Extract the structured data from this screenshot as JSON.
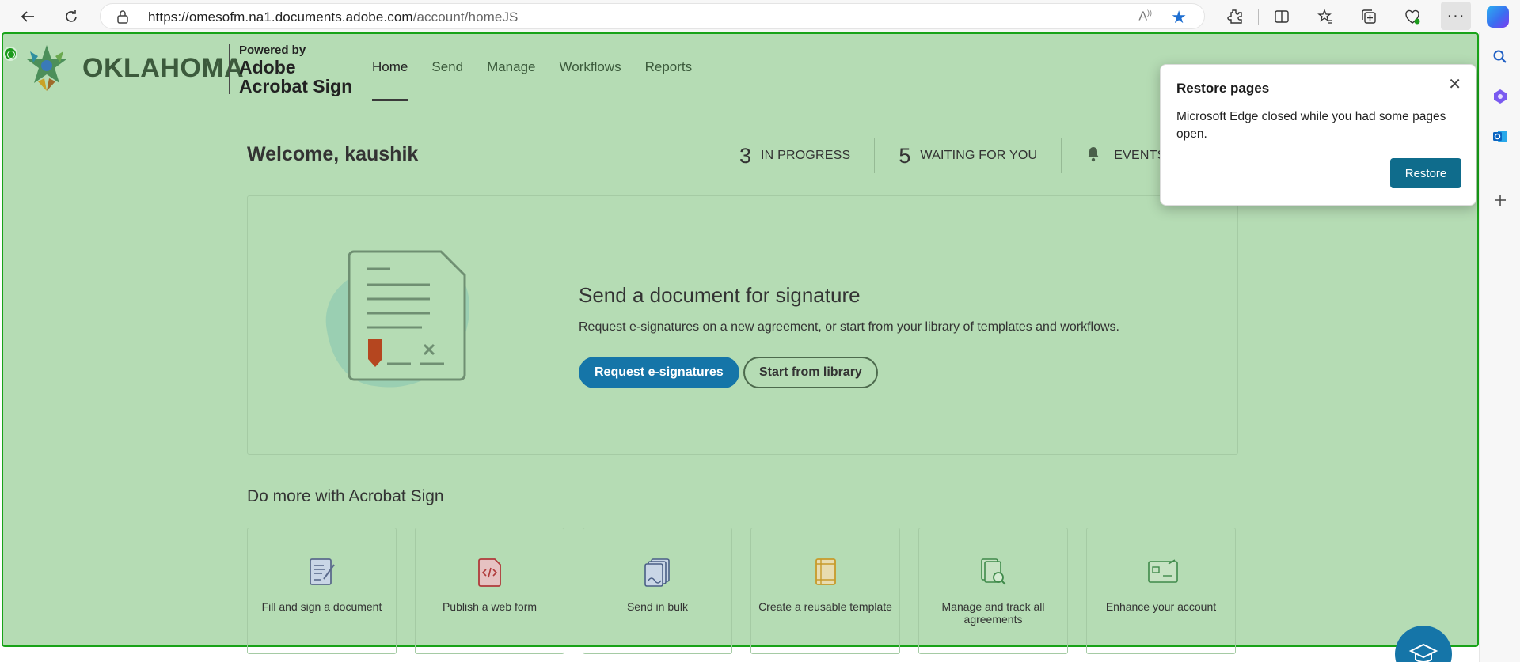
{
  "browser": {
    "url_host": "https://omesofm.na1.documents.adobe.com",
    "url_path": "/account/homeJS",
    "more_label": "···"
  },
  "site": {
    "brand": "OKLAHOMA",
    "powered_by": "Powered by",
    "adobe_line1": "Adobe",
    "adobe_line2": "Acrobat Sign",
    "nav": [
      "Home",
      "Send",
      "Manage",
      "Workflows",
      "Reports"
    ],
    "active_nav": "Home"
  },
  "welcome": "Welcome, kaushik",
  "stats": [
    {
      "count": "3",
      "label": "IN PROGRESS"
    },
    {
      "count": "5",
      "label": "WAITING FOR YOU"
    },
    {
      "count": "",
      "label": "EVENTS A"
    }
  ],
  "hero": {
    "title": "Send a document for signature",
    "subtitle": "Request e-signatures on a new agreement, or start from your library of templates and workflows.",
    "primary_button": "Request e-signatures",
    "secondary_button": "Start from library"
  },
  "section_title": "Do more with Acrobat Sign",
  "cards": [
    {
      "label": "Fill and sign a document",
      "icon": "fill-sign-icon"
    },
    {
      "label": "Publish a web form",
      "icon": "web-form-icon"
    },
    {
      "label": "Send in bulk",
      "icon": "send-bulk-icon"
    },
    {
      "label": "Create a reusable template",
      "icon": "template-icon"
    },
    {
      "label": "Manage and track all agreements",
      "icon": "manage-track-icon"
    },
    {
      "label": "Enhance your account",
      "icon": "enhance-account-icon"
    }
  ],
  "restore_popup": {
    "title": "Restore pages",
    "message": "Microsoft Edge closed while you had some pages open.",
    "button": "Restore"
  },
  "colors": {
    "page_overlay": "#b5dcb4",
    "primary_button": "#1575a8",
    "restore_button": "#0f6c8c",
    "highlight_border": "#18a318"
  }
}
